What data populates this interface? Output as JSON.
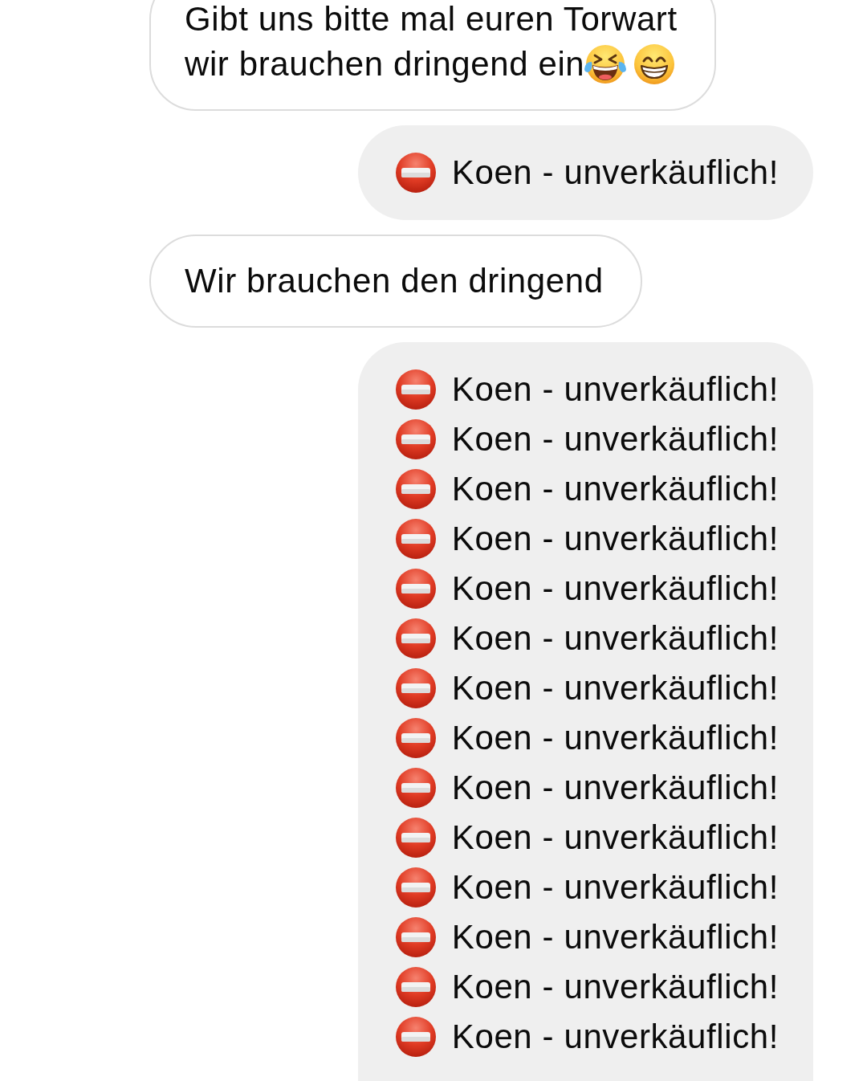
{
  "messages": [
    {
      "kind": "received",
      "lines": [
        {
          "text": "Gibt uns bitte mal euren Torwart"
        },
        {
          "text": "wir brauchen dringend ein",
          "icons_after": [
            {
              "kind": "laughing"
            },
            {
              "kind": "grinning"
            }
          ]
        }
      ]
    },
    {
      "kind": "sent",
      "lines": [
        {
          "icon_before": {
            "kind": "no-entry"
          },
          "text": "Koen - unverkäuflich!"
        }
      ]
    },
    {
      "kind": "received",
      "lines": [
        {
          "text": "Wir brauchen den dringend"
        }
      ]
    },
    {
      "kind": "sent",
      "lines": [
        {
          "icon_before": {
            "kind": "no-entry"
          },
          "text": "Koen - unverkäuflich!"
        },
        {
          "icon_before": {
            "kind": "no-entry"
          },
          "text": "Koen - unverkäuflich!"
        },
        {
          "icon_before": {
            "kind": "no-entry"
          },
          "text": "Koen - unverkäuflich!"
        },
        {
          "icon_before": {
            "kind": "no-entry"
          },
          "text": "Koen - unverkäuflich!"
        },
        {
          "icon_before": {
            "kind": "no-entry"
          },
          "text": "Koen - unverkäuflich!"
        },
        {
          "icon_before": {
            "kind": "no-entry"
          },
          "text": "Koen - unverkäuflich!"
        },
        {
          "icon_before": {
            "kind": "no-entry"
          },
          "text": "Koen - unverkäuflich!"
        },
        {
          "icon_before": {
            "kind": "no-entry"
          },
          "text": "Koen - unverkäuflich!"
        },
        {
          "icon_before": {
            "kind": "no-entry"
          },
          "text": "Koen - unverkäuflich!"
        },
        {
          "icon_before": {
            "kind": "no-entry"
          },
          "text": "Koen - unverkäuflich!"
        },
        {
          "icon_before": {
            "kind": "no-entry"
          },
          "text": "Koen - unverkäuflich!"
        },
        {
          "icon_before": {
            "kind": "no-entry"
          },
          "text": "Koen - unverkäuflich!"
        },
        {
          "icon_before": {
            "kind": "no-entry"
          },
          "text": "Koen - unverkäuflich!"
        },
        {
          "icon_before": {
            "kind": "no-entry"
          },
          "text": "Koen - unverkäuflich!"
        }
      ]
    }
  ]
}
